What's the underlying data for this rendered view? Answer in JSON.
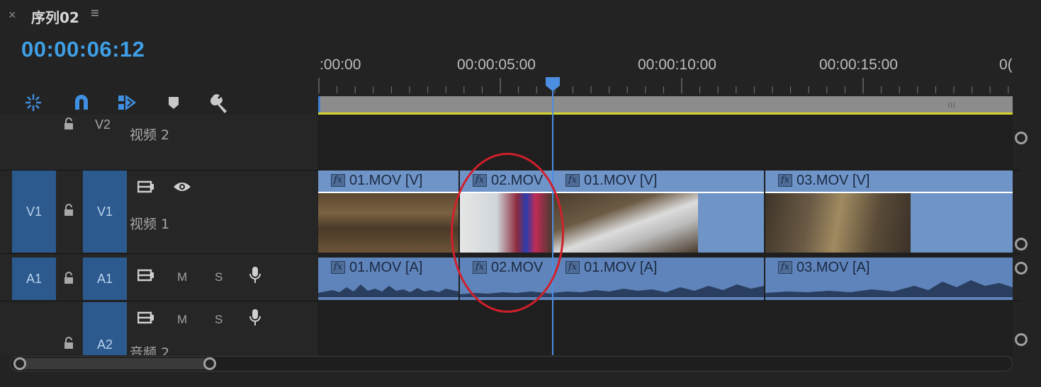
{
  "tab": {
    "close": "×",
    "title": "序列02",
    "menu": "≡"
  },
  "timecode": "00:00:06:12",
  "ruler": {
    "labels": [
      ":00:00",
      "00:00:05:00",
      "00:00:10:00",
      "00:00:15:00",
      "0("
    ]
  },
  "tracks": {
    "v2": {
      "target": "V2",
      "name": "视频 2"
    },
    "v1": {
      "source": "V1",
      "target": "V1",
      "name": "视频 1"
    },
    "a1": {
      "source": "A1",
      "target": "A1",
      "m": "M",
      "s": "S"
    },
    "a2": {
      "target": "A2",
      "name": "音频 2",
      "m": "M",
      "s": "S"
    }
  },
  "clips": {
    "video": [
      {
        "label": "01.MOV [V]"
      },
      {
        "label": "02.MOV"
      },
      {
        "label": "01.MOV [V]"
      },
      {
        "label": "03.MOV [V]"
      }
    ],
    "audio": [
      {
        "label": "01.MOV [A]"
      },
      {
        "label": "02.MOV"
      },
      {
        "label": "01.MOV [A]"
      },
      {
        "label": "03.MOV [A]"
      }
    ],
    "fx": "fx"
  },
  "work_bar_grip": "III",
  "colors": {
    "accent": "#3f9fe6",
    "clip_video": "#6f94c8",
    "clip_audio": "#5f84bb",
    "highlight": "#d0202a",
    "work_area": "#d5d52b"
  }
}
